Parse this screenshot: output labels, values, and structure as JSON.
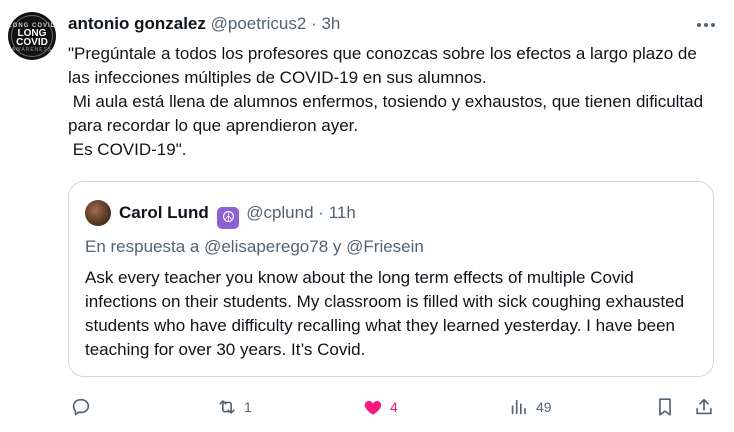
{
  "tweet": {
    "author_name": "antonio gonzalez",
    "handle": "@poetricus2",
    "separator": "·",
    "time": "3h",
    "avatar_text": {
      "top": "LONG COVID",
      "main_1": "LONG",
      "main_2": "COVID",
      "bottom": "AWARENESS"
    },
    "text": "\"Pregúntale a todos los profesores que conozcas sobre los efectos a largo plazo de las infecciones múltiples de COVID-19 en sus alumnos.\n Mi aula está llena de alumnos enfermos, tosiendo y exhaustos, que tienen dificultad para recordar lo que aprendieron ayer.\n Es COVID-19\"."
  },
  "quoted": {
    "author_name": "Carol Lund",
    "badge": "☮",
    "handle": "@cplund",
    "separator": "·",
    "time": "11h",
    "reply_prefix": "En respuesta a",
    "reply_mention_1": "@elisaperego78",
    "reply_and": "y",
    "reply_mention_2": "@Friesein",
    "text": "Ask every teacher you know about the long term effects of multiple Covid infections on their students. My classroom is filled with sick coughing exhausted students who have difficulty recalling what they learned yesterday. I have been teaching for over 30 years. It’s Covid."
  },
  "actions": {
    "reply_count": "",
    "retweet_count": "1",
    "like_count": "4",
    "views_count": "49"
  },
  "colors": {
    "text": "#0f1419",
    "muted": "#536471",
    "border": "#cfd9de",
    "like": "#f91880",
    "badge": "#8f5fd4"
  }
}
